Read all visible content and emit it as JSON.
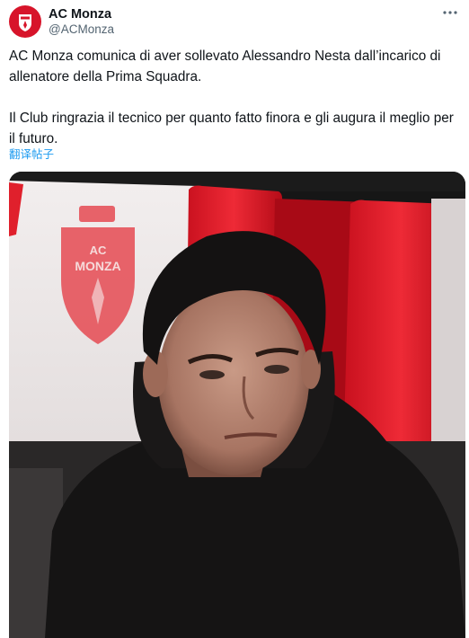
{
  "account": {
    "display_name": "AC Monza",
    "handle": "@ACMonza"
  },
  "more_icon": "more-horizontal-icon",
  "post": {
    "paragraphs": [
      "AC Monza comunica di aver sollevato Alessandro Nesta dall’incarico di allenatore della Prima Squadra.",
      "Il Club ringrazia il tecnico per quanto fatto finora e gli augura il meglio per il futuro."
    ],
    "translate_label": "翻译帖子"
  },
  "media": {
    "seat_logo_text": [
      "AC",
      "MONZA"
    ]
  },
  "colors": {
    "brand_red": "#d7142a",
    "link_blue": "#1d9bf0",
    "secondary_text": "#536471"
  }
}
